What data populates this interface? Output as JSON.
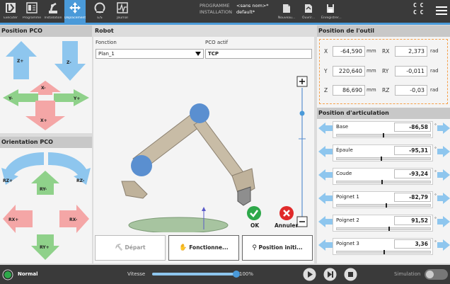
{
  "nav": {
    "tabs": [
      {
        "id": "run",
        "label": "Exécuter",
        "icon": "run-icon"
      },
      {
        "id": "program",
        "label": "Programme",
        "icon": "program-icon"
      },
      {
        "id": "installation",
        "label": "Installation",
        "icon": "installation-icon"
      },
      {
        "id": "move",
        "label": "Déplacement",
        "icon": "move-icon",
        "active": true
      },
      {
        "id": "io",
        "label": "E/S",
        "icon": "io-icon"
      },
      {
        "id": "log",
        "label": "Journal",
        "icon": "log-icon"
      }
    ],
    "program_label": "PROGRAMME",
    "program_value": "<sans nom>*",
    "installation_label": "INSTALLATION",
    "installation_value": "default*",
    "file_buttons": [
      {
        "id": "new",
        "label": "Nouveau..."
      },
      {
        "id": "open",
        "label": "Ouvrir..."
      },
      {
        "id": "save",
        "label": "Enregistrer..."
      }
    ],
    "mode_glyph": "C C\nC C"
  },
  "pco_position": {
    "title": "Position PCO",
    "labels": {
      "zp": "Z+",
      "zm": "Z-",
      "xm": "X-",
      "xp": "X+",
      "ym": "Y-",
      "yp": "Y+"
    }
  },
  "pco_orientation": {
    "title": "Orientation PCO",
    "labels": {
      "rzp": "RZ+",
      "rzm": "RZ-",
      "ryp": "RY+",
      "rym": "RY-",
      "rxp": "RX+",
      "rxm": "RX-"
    }
  },
  "robot": {
    "title": "Robot",
    "function_label": "Fonction",
    "function_value": "Plan_1",
    "tcp_label": "PCO actif",
    "tcp_value": "TCP",
    "ok_label": "OK",
    "cancel_label": "Annuler",
    "home_label": "Départ",
    "freedrive_label": "Fonctionne...",
    "init_label": "Position initi..."
  },
  "tool_position": {
    "title": "Position de l'outil",
    "rows": [
      {
        "axis": "X",
        "value": "-64,590",
        "unit": "mm",
        "rot_axis": "RX",
        "rot_value": "2,373",
        "rot_unit": "rad"
      },
      {
        "axis": "Y",
        "value": "220,640",
        "unit": "mm",
        "rot_axis": "RY",
        "rot_value": "-0,011",
        "rot_unit": "rad"
      },
      {
        "axis": "Z",
        "value": "86,690",
        "unit": "mm",
        "rot_axis": "RZ",
        "rot_value": "-0,03",
        "rot_unit": "rad"
      }
    ]
  },
  "joints": {
    "title": "Position d'articulation",
    "unit": "°",
    "items": [
      {
        "name": "Base",
        "value": "-86,58",
        "fraction": 0.49
      },
      {
        "name": "Épaule",
        "value": "-95,31",
        "fraction": 0.47
      },
      {
        "name": "Coude",
        "value": "-93,24",
        "fraction": 0.48
      },
      {
        "name": "Poignet 1",
        "value": "-82,79",
        "fraction": 0.52
      },
      {
        "name": "Poignet 2",
        "value": "91,52",
        "fraction": 0.55
      },
      {
        "name": "Poignet 3",
        "value": "3,36",
        "fraction": 0.5
      }
    ]
  },
  "status": {
    "mode": "Normal",
    "speed_label": "Vitesse",
    "speed_value": "100%",
    "speed_fraction": 1.0,
    "simulation_label": "Simulation"
  },
  "colors": {
    "accent": "#4a9ad9",
    "arrow_blue": "#8ec6ee",
    "arrow_pink": "#f4a6a6",
    "arrow_green": "#8fd18a",
    "ok_green": "#2ea84a",
    "cancel_red": "#e02a2a",
    "tool_border": "#f5a04a",
    "joint_blue": "#8ec6ee"
  }
}
